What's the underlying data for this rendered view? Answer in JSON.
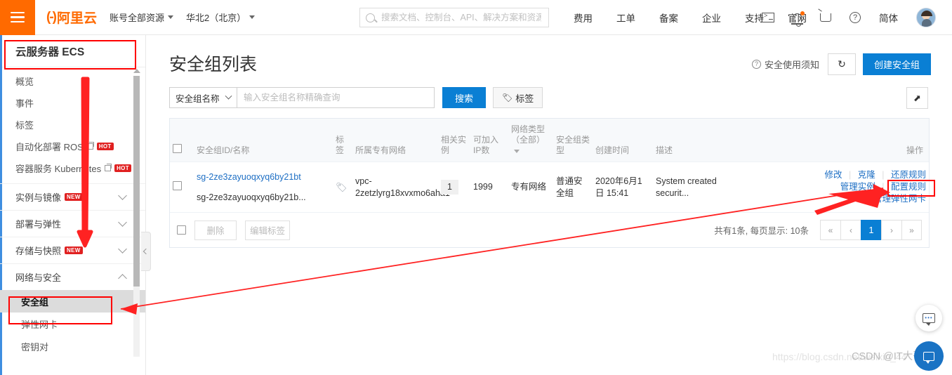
{
  "topbar": {
    "menu_icon": "hamburger-icon",
    "logo_text": "阿里云",
    "logo_mark": "(-)",
    "resource_selector": "账号全部资源",
    "region_selector": "华北2（北京）",
    "search_placeholder": "搜索文档、控制台、API、解决方案和资源",
    "nav_items": [
      {
        "label": "费用"
      },
      {
        "label": "工单"
      },
      {
        "label": "备案"
      },
      {
        "label": "企业"
      },
      {
        "label": "支持"
      },
      {
        "label": "官网"
      }
    ],
    "icons": [
      {
        "name": "console-terminal-icon"
      },
      {
        "name": "bell-notification-icon"
      },
      {
        "name": "shopping-cart-icon"
      },
      {
        "name": "help-question-icon"
      }
    ],
    "language": "简体",
    "avatar": "user-avatar"
  },
  "sidebar": {
    "title": "云服务器 ECS",
    "items": [
      {
        "label": "概览",
        "type": "link"
      },
      {
        "label": "事件",
        "type": "link"
      },
      {
        "label": "标签",
        "type": "link"
      },
      {
        "label": "自动化部署 ROS",
        "type": "link",
        "external": true,
        "badge": "HOT"
      },
      {
        "label": "容器服务 Kubernetes",
        "type": "link",
        "external": true,
        "badge": "HOT"
      },
      {
        "label": "实例与镜像",
        "type": "group",
        "badge": "NEW",
        "expanded": false
      },
      {
        "label": "部署与弹性",
        "type": "group",
        "expanded": false
      },
      {
        "label": "存储与快照",
        "type": "group",
        "badge": "NEW",
        "expanded": false
      },
      {
        "label": "网络与安全",
        "type": "group",
        "expanded": true
      }
    ],
    "sub_items": [
      {
        "label": "安全组",
        "active": true
      },
      {
        "label": "弹性网卡",
        "active": false
      },
      {
        "label": "密钥对",
        "active": false
      }
    ]
  },
  "main": {
    "page_title": "安全组列表",
    "security_hint": "安全使用须知",
    "refresh_icon": "refresh-icon",
    "create_button": "创建安全组",
    "filter": {
      "select_value": "安全组名称",
      "input_value": "",
      "input_placeholder": "输入安全组名称精确查询",
      "search_button": "搜索",
      "tag_button": "标签",
      "export_icon": "export-icon"
    },
    "table": {
      "columns": [
        "安全组ID/名称",
        "标签",
        "所属专有网络",
        "相关实例",
        "可加入IP数",
        "网络类型（全部）",
        "安全组类型",
        "创建时间",
        "描述",
        "操作"
      ],
      "rows": [
        {
          "sg_id": "sg-2ze3zayuoqxyq6by21bt",
          "sg_name": "sg-2ze3zayuoqxyq6by21b...",
          "tag_icon": "tag-icon",
          "vpc": "vpc-2zetzlyrg18xvxmo6aha1",
          "instances": "1",
          "ip_count": "1999",
          "network_type": "专有网络",
          "sg_type": "普通安全组",
          "created": "2020年6月1日 15:41",
          "description": "System created securit...",
          "actions_row1": [
            "修改",
            "克隆",
            "还原规则"
          ],
          "actions_row2": [
            "管理实例",
            "配置规则"
          ],
          "actions_row3": [
            "管理弹性网卡"
          ]
        }
      ]
    },
    "footer": {
      "delete_button": "删除",
      "edit_tag_button": "编辑标签",
      "total_text": "共有1条, 每页显示: 10条",
      "pager": [
        "«",
        "‹",
        "1",
        "›",
        "»"
      ],
      "current_page": "1"
    }
  },
  "floating": {
    "chat_icon": "chat-bubble-icon",
    "feedback_icon": "feedback-icon"
  },
  "watermark": {
    "url": "https://blog.csdn.net/weixin_44",
    "author": "CSDN @IT大哥哥4"
  },
  "annotations": {
    "highlight_color": "#ff0000",
    "boxes": [
      "sidebar-title-box",
      "security-group-menu-box",
      "config-rules-box"
    ],
    "arrows": [
      "arrow-down-to-security-group",
      "arrow-from-config-rules-to-menu"
    ]
  }
}
